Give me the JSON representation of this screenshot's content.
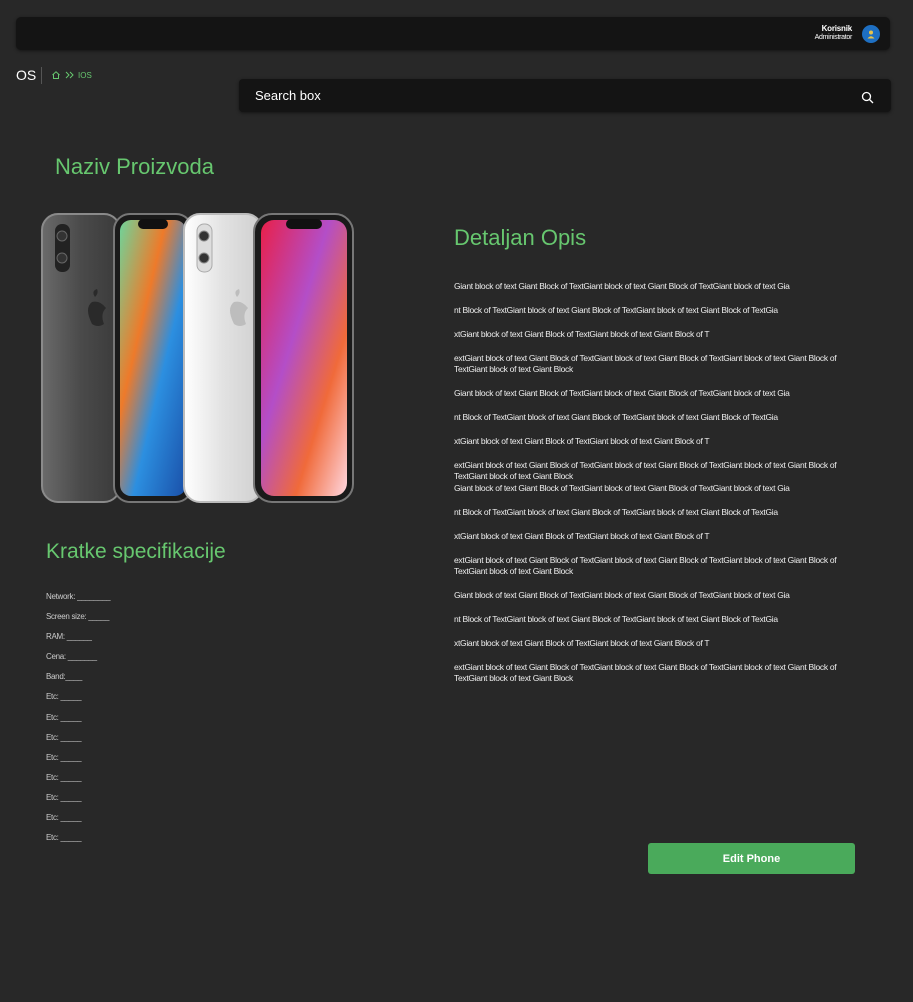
{
  "header": {
    "user_name": "Korisnik",
    "user_role": "Administrator"
  },
  "page": {
    "title": "OS",
    "breadcrumb_current": "IOS"
  },
  "search": {
    "label": "Search box"
  },
  "product": {
    "name": "Naziv Proizvoda"
  },
  "description": {
    "title": "Detaljan Opis",
    "paragraphs": [
      "Giant block of text Giant Block of TextGiant block of text Giant Block of TextGiant block of text Gia",
      "nt Block of TextGiant block of text Giant Block of TextGiant block of text Giant Block of TextGia",
      "xtGiant block of text Giant Block of TextGiant block of text Giant Block of T",
      "extGiant block of text Giant Block of TextGiant block of text Giant Block of TextGiant block of text Giant Block of TextGiant block of text Giant Block",
      "Giant block of text Giant Block of TextGiant block of text Giant Block of TextGiant block of text Gia",
      "nt Block of TextGiant block of text Giant Block of TextGiant block of text Giant Block of TextGia",
      "xtGiant block of text Giant Block of TextGiant block of text Giant Block of T",
      "extGiant block of text Giant Block of TextGiant block of text Giant Block of TextGiant block of text Giant Block of TextGiant block of text Giant Block",
      "Giant block of text Giant Block of TextGiant block of text Giant Block of TextGiant block of text Gia",
      "nt Block of TextGiant block of text Giant Block of TextGiant block of text Giant Block of TextGia",
      "xtGiant block of text Giant Block of TextGiant block of text Giant Block of T",
      "extGiant block of text Giant Block of TextGiant block of text Giant Block of TextGiant block of text Giant Block of TextGiant block of text Giant Block",
      "Giant block of text Giant Block of TextGiant block of text Giant Block of TextGiant block of text Gia",
      "nt Block of TextGiant block of text Giant Block of TextGiant block of text Giant Block of TextGia",
      "xtGiant block of text Giant Block of TextGiant block of text Giant Block of T",
      "extGiant block of text Giant Block of TextGiant block of text Giant Block of TextGiant block of text Giant Block of TextGiant block of text Giant Block"
    ]
  },
  "specs": {
    "title": "Kratke specifikacije",
    "rows": [
      "Network: ________",
      "Screen size: _____",
      "RAM: ______",
      "Cena: _______",
      "Band:____",
      "Etc: _____",
      "Etc: _____",
      "Etc: _____",
      "Etc: _____",
      "Etc: _____",
      "Etc: _____",
      "Etc: _____",
      "Etc: _____"
    ]
  },
  "actions": {
    "edit_label": "Edit Phone"
  },
  "colors": {
    "accent": "#67c76f",
    "button": "#4aaa5b",
    "background": "#282828",
    "bar": "#141414"
  },
  "icons": {
    "home": "home-icon",
    "breadcrumb_sep": "double-chevron-right-icon",
    "search": "search-icon",
    "avatar": "user-avatar-icon"
  }
}
